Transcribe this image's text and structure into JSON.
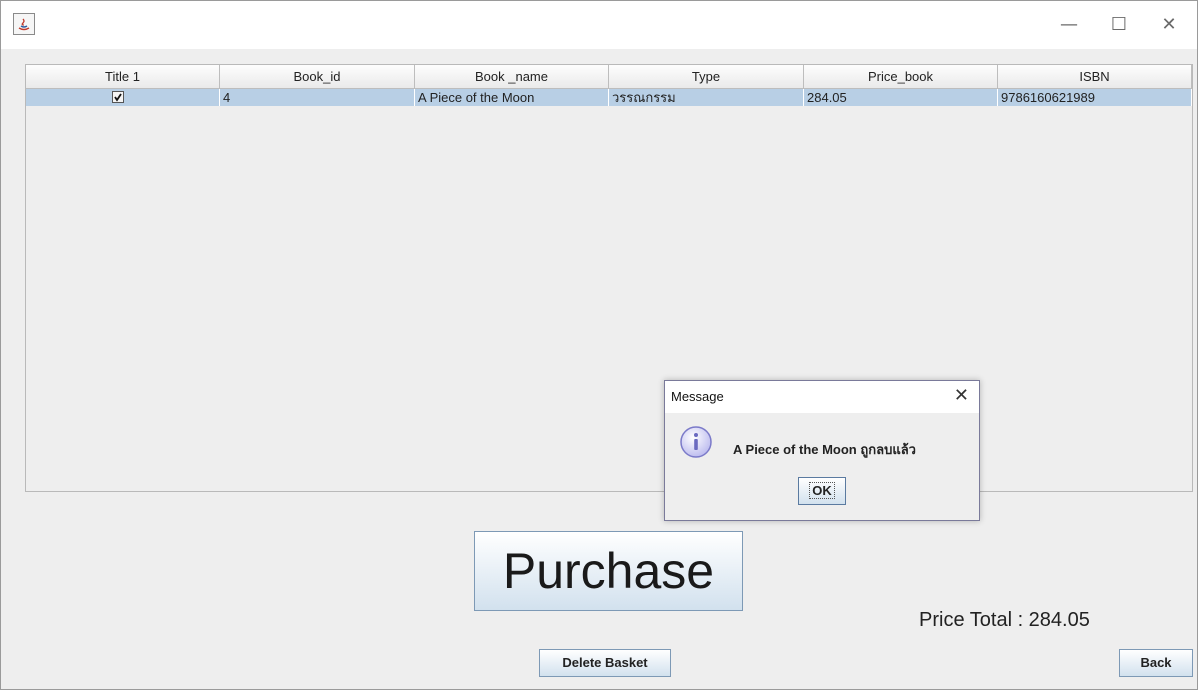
{
  "window": {
    "controls": {
      "minimize": "—",
      "maximize": "☐",
      "close": "✕"
    }
  },
  "table": {
    "columns": [
      "Title 1",
      "Book_id",
      "Book _name",
      "Type",
      "Price_book",
      "ISBN"
    ],
    "rows": [
      {
        "checked": true,
        "book_id": "4",
        "book_name": "A Piece of the Moon",
        "type": "วรรณกรรม",
        "price": "284.05",
        "isbn": "9786160621989"
      }
    ]
  },
  "actions": {
    "purchase_label": "Purchase",
    "delete_label": "Delete Basket",
    "back_label": "Back"
  },
  "total": {
    "text": "Price Total :  284.05"
  },
  "dialog": {
    "title": "Message",
    "message": "A Piece of the Moon ถูกลบแล้ว",
    "ok_label": "OK",
    "close": "✕"
  },
  "colors": {
    "row_selected": "#b8cfe5",
    "button_border": "#7d99b5",
    "info_icon": "#8f8ed9"
  }
}
